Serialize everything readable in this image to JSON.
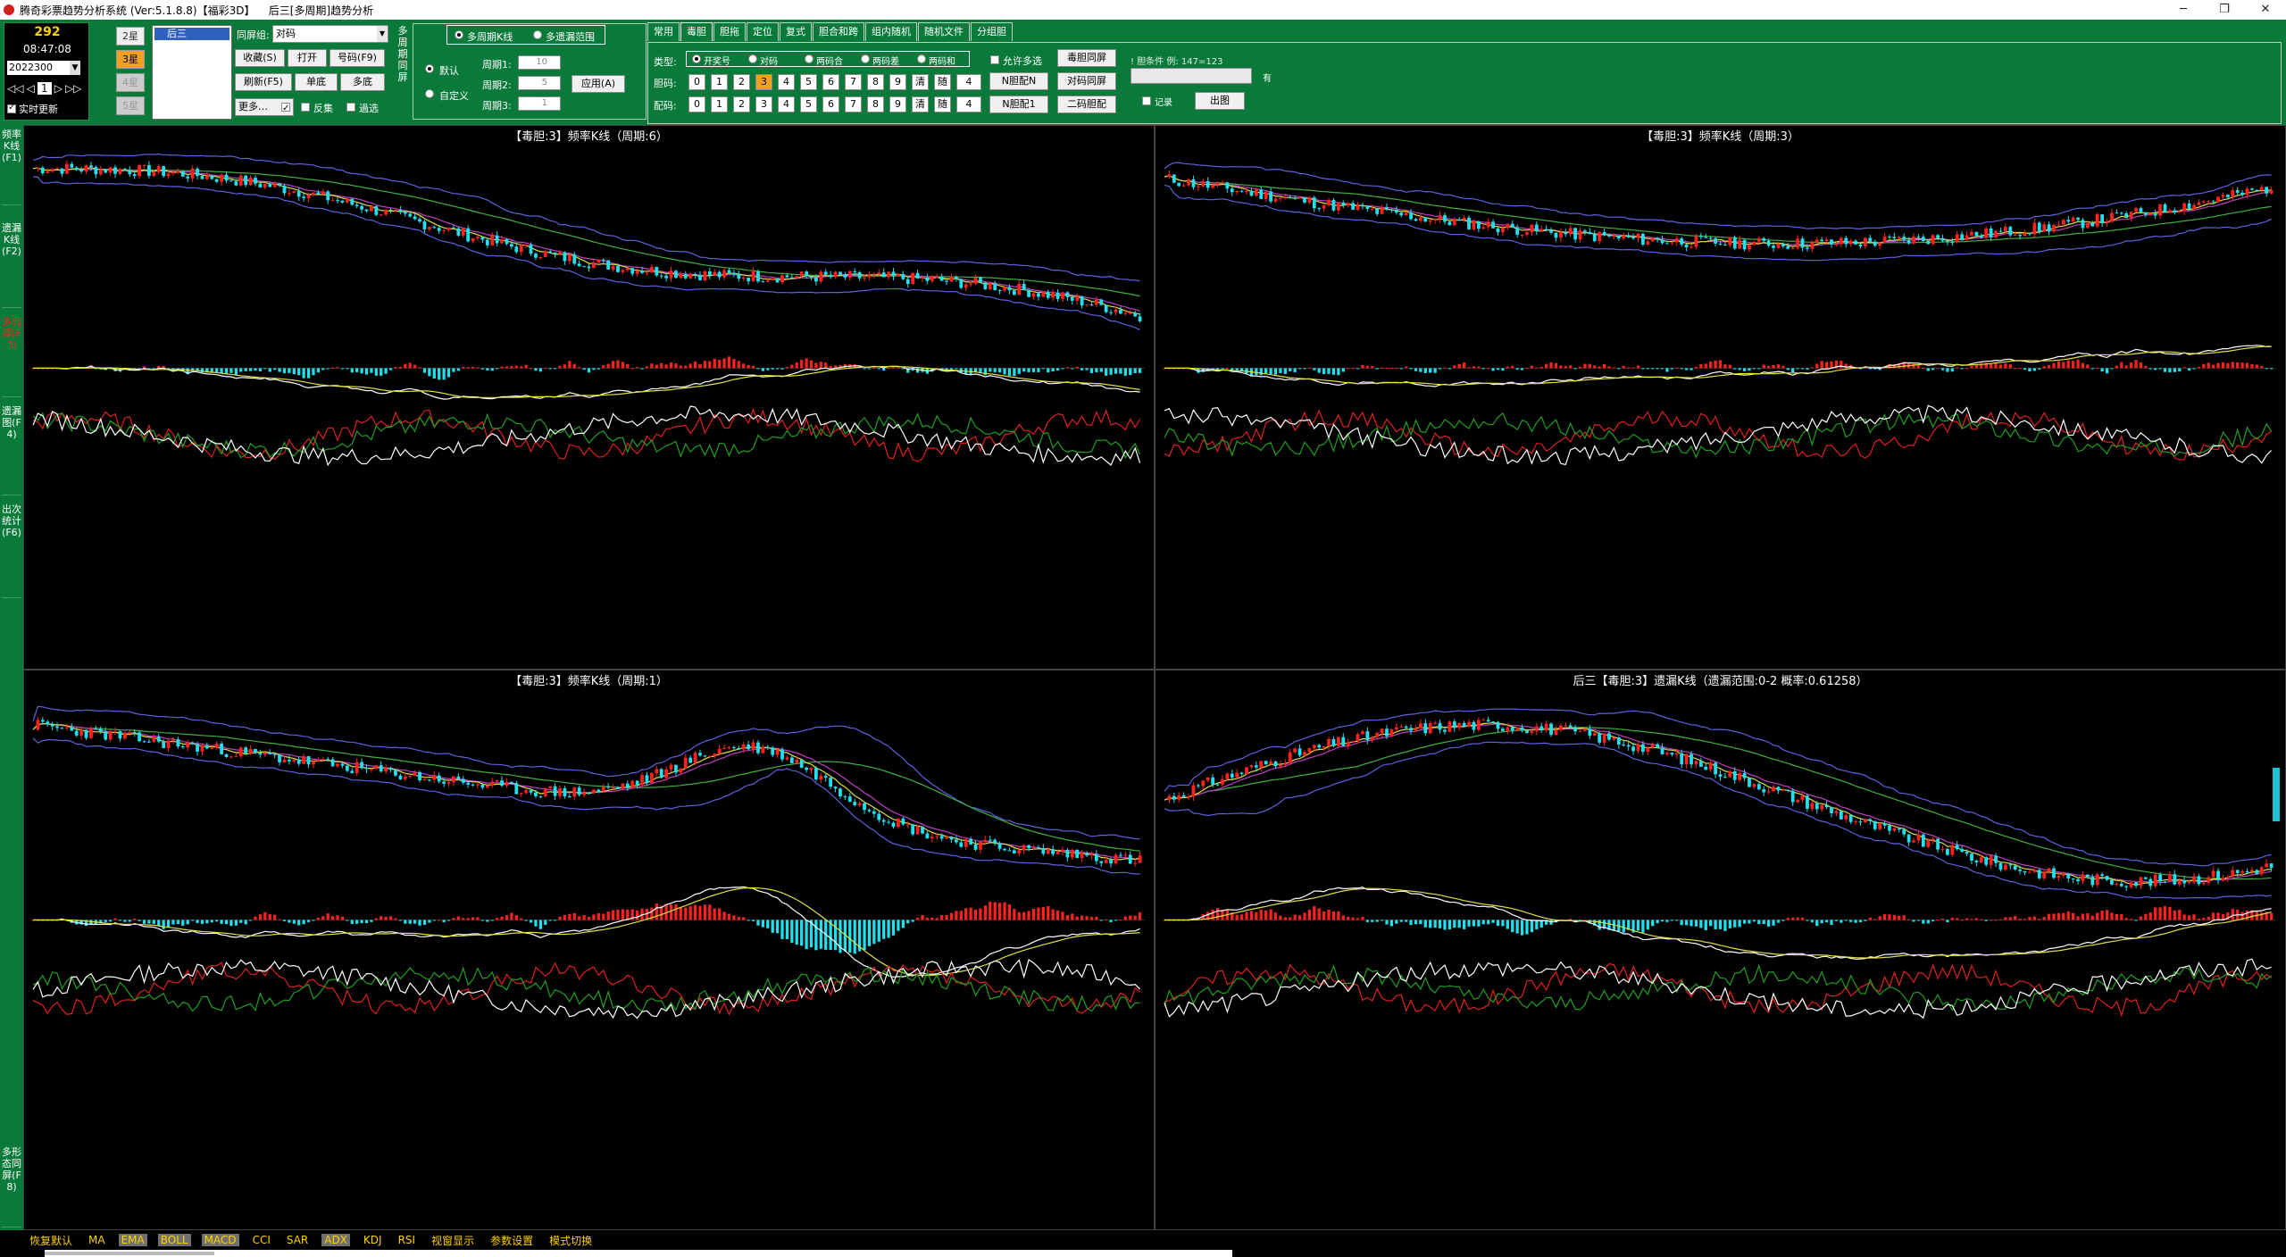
{
  "window": {
    "title": "腾奇彩票趋势分析系统 (Ver:5.1.8.8)【福彩3D】    后三[多周期]趋势分析",
    "controls": [
      "─",
      "❐",
      "✕"
    ]
  },
  "info": {
    "number": "292",
    "time": "08:47:08",
    "issue": "2022300",
    "nav": {
      "first": "◁◁",
      "prev": "◁",
      "page": "1",
      "next": "▷",
      "last": "▷▷"
    },
    "realtime_label": "实时更新"
  },
  "stars": [
    "2星",
    "3星",
    "4星",
    "5星"
  ],
  "list": {
    "selected": "后三"
  },
  "group_controls": {
    "screen_group_label": "同屏组:",
    "screen_group_value": "对码",
    "buttons": [
      "收藏(S)",
      "打开",
      "号码(F9)",
      "刷新(F5)",
      "单底",
      "多底",
      "更多…"
    ],
    "reverse_label": "反集",
    "filter_label": "過选"
  },
  "multi_period": {
    "vertical_label": "多周期同屏",
    "radio_multi_k": "多周期K线",
    "radio_multi_miss": "多遗漏范围",
    "radio_default": "默认",
    "radio_custom": "自定义",
    "periods": [
      {
        "label": "周期1:",
        "value": "10"
      },
      {
        "label": "周期2:",
        "value": "5"
      },
      {
        "label": "周期3:",
        "value": "1"
      }
    ],
    "apply_button": "应用(A)"
  },
  "tabs": [
    "常用",
    "毒胆",
    "胆拖",
    "定位",
    "复式",
    "胆合和跨",
    "组内随机",
    "随机文件",
    "分组胆"
  ],
  "active_tab": "毒胆",
  "dudan": {
    "type_label": "类型:",
    "type_options": [
      "开奖号",
      "对码",
      "两码合",
      "两码差",
      "两码和"
    ],
    "allow_multi_label": "允许多选",
    "same_screen_btn": "毒胆同屏",
    "gall_label": "胆码:",
    "pair_label": "配码:",
    "digits": [
      "0",
      "1",
      "2",
      "3",
      "4",
      "5",
      "6",
      "7",
      "8",
      "9"
    ],
    "selected_digit": "3",
    "clear_label": "清",
    "random_label": "随",
    "random_count": "4",
    "btn_n_pair": "N胆配N",
    "btn_pair_same": "对码同屏",
    "btn_n_pair1": "N胆配1",
    "btn_two_pair": "二码胆配",
    "condition_label": "! 胆条件 例: 147=123",
    "record_label": "记录",
    "output_btn": "出图",
    "arrow": "有"
  },
  "leftnav": [
    {
      "label": "频率K线(F1)",
      "active": false
    },
    {
      "label": "遗漏K线(F2)",
      "active": false
    },
    {
      "label": "多周期(F3)",
      "active": true
    },
    {
      "label": "遗漏图(F4)",
      "active": false
    },
    {
      "label": "出次统计(F6)",
      "active": false
    },
    {
      "label": "多形态同屏(F8)",
      "active": false
    }
  ],
  "panels": [
    {
      "title": "【毒胆:3】频率K线（周期:6）"
    },
    {
      "title": "【毒胆:3】频率K线（周期:3）"
    },
    {
      "title": "【毒胆:3】频率K线（周期:1）"
    },
    {
      "title": "后三【毒胆:3】遗漏K线（遗漏范围:0-2 概率:0.61258）"
    }
  ],
  "bottom": {
    "items": [
      "恢复默认",
      "MA",
      "EMA",
      "BOLL",
      "MACD",
      "CCI",
      "SAR",
      "ADX",
      "KDJ",
      "RSI",
      "视窗显示",
      "参数设置",
      "模式切换"
    ],
    "selected": [
      "EMA",
      "BOLL",
      "MACD",
      "ADX"
    ]
  },
  "colors": {
    "panel_bg": "#000000",
    "toolbar_bg": "#0a7a3a",
    "up_candle": "#ff2020",
    "down_candle": "#20e0f0",
    "boll": "#6060e0",
    "ma_slow": "#40b040",
    "accent": "#ffd000"
  }
}
